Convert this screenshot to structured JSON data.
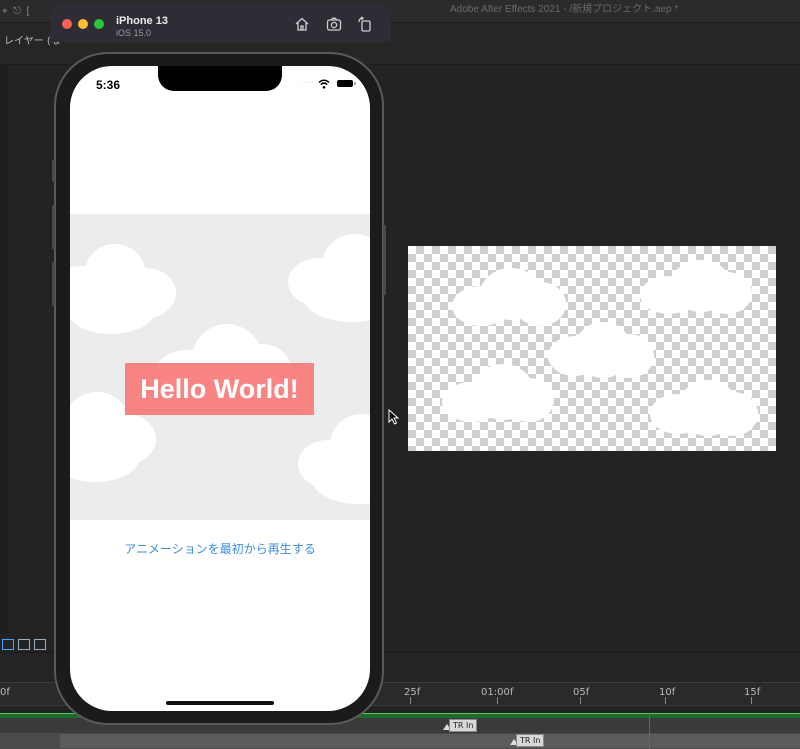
{
  "after_effects": {
    "title_text": "Adobe After Effects 2021 - /新規プロジェクト.aep *",
    "panel_label": "レイヤー (な",
    "ruler_labels": [
      "0f",
      "25f",
      "01:00f",
      "05f",
      "10f",
      "15f"
    ],
    "markers": [
      "TR In",
      "TR In"
    ],
    "colors": {
      "work_area": "#1e6b2a",
      "playhead": "#e03030"
    }
  },
  "simulator": {
    "device_name": "iPhone 13",
    "os_version": "iOS 15.0",
    "toolbar_icons": [
      "home-icon",
      "screenshot-icon",
      "rotate-icon"
    ]
  },
  "phone": {
    "status_bar": {
      "time": "5:36",
      "signal": "····",
      "icons": [
        "wifi-icon",
        "battery-icon"
      ]
    },
    "hello_label": "Hello World!",
    "replay_button": "アニメーションを最初から再生する",
    "colors": {
      "label_background": "#f87979",
      "link": "#3b8de0",
      "animation_background": "#ececec"
    }
  }
}
